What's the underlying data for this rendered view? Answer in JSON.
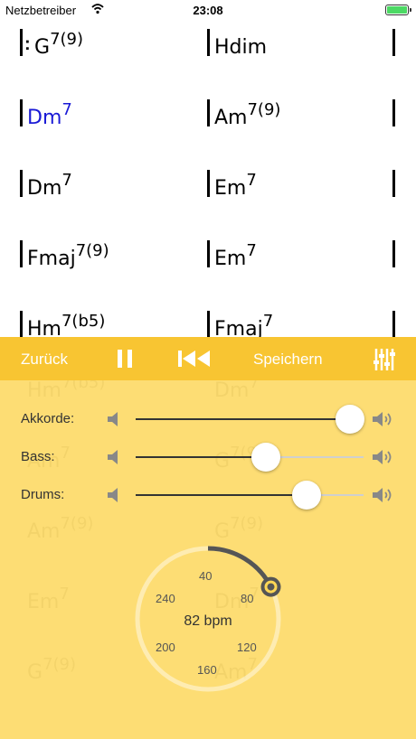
{
  "status": {
    "carrier": "Netzbetreiber",
    "time": "23:08",
    "battery_level": 1.0
  },
  "sheet": {
    "rows": [
      {
        "left": {
          "root": "G",
          "ext": "7(9)",
          "repeat": true
        },
        "right": {
          "root": "Hdim",
          "ext": ""
        }
      },
      {
        "left": {
          "root": "Dm",
          "ext": "7",
          "highlight": true
        },
        "right": {
          "root": "Am",
          "ext": "7(9)"
        }
      },
      {
        "left": {
          "root": "Dm",
          "ext": "7"
        },
        "right": {
          "root": "Em",
          "ext": "7"
        }
      },
      {
        "left": {
          "root": "Fmaj",
          "ext": "7(9)"
        },
        "right": {
          "root": "Em",
          "ext": "7"
        }
      },
      {
        "left": {
          "root": "Hm",
          "ext": "7(b5)"
        },
        "right": {
          "root": "Fmaj",
          "ext": "7"
        }
      }
    ],
    "faded_rows": [
      {
        "left": {
          "root": "Hm",
          "ext": "7(b5)"
        },
        "right": {
          "root": "Dm",
          "ext": "7"
        }
      },
      {
        "left": {
          "root": "Am",
          "ext": "7"
        },
        "right": {
          "root": "G",
          "ext": "7(9)"
        }
      },
      {
        "left": {
          "root": "Am",
          "ext": "7(9)"
        },
        "right": {
          "root": "G",
          "ext": "7(9)"
        }
      },
      {
        "left": {
          "root": "Em",
          "ext": "7"
        },
        "right": {
          "root": "Dm",
          "ext": "7"
        }
      },
      {
        "left": {
          "root": "G",
          "ext": "7(9)"
        },
        "right": {
          "root": "Am",
          "ext": "7"
        }
      }
    ]
  },
  "toolbar": {
    "back_label": "Zurück",
    "save_label": "Speichern",
    "pause_icon": "pause-icon",
    "rewind_icon": "skip-to-start-icon",
    "mixer_icon": "mixer-sliders-icon"
  },
  "mixer": [
    {
      "label": "Akkorde:",
      "level": 0.94
    },
    {
      "label": "Bass:",
      "level": 0.57
    },
    {
      "label": "Drums:",
      "level": 0.75
    }
  ],
  "tempo": {
    "bpm_label": "82 bpm",
    "bpm": 82,
    "ticks": [
      "40",
      "80",
      "120",
      "160",
      "200",
      "240"
    ]
  },
  "colors": {
    "accent": "#f8c532",
    "panel": "#fdd655",
    "highlight_chord": "#1a1ad6",
    "dial_arc": "#555555"
  }
}
